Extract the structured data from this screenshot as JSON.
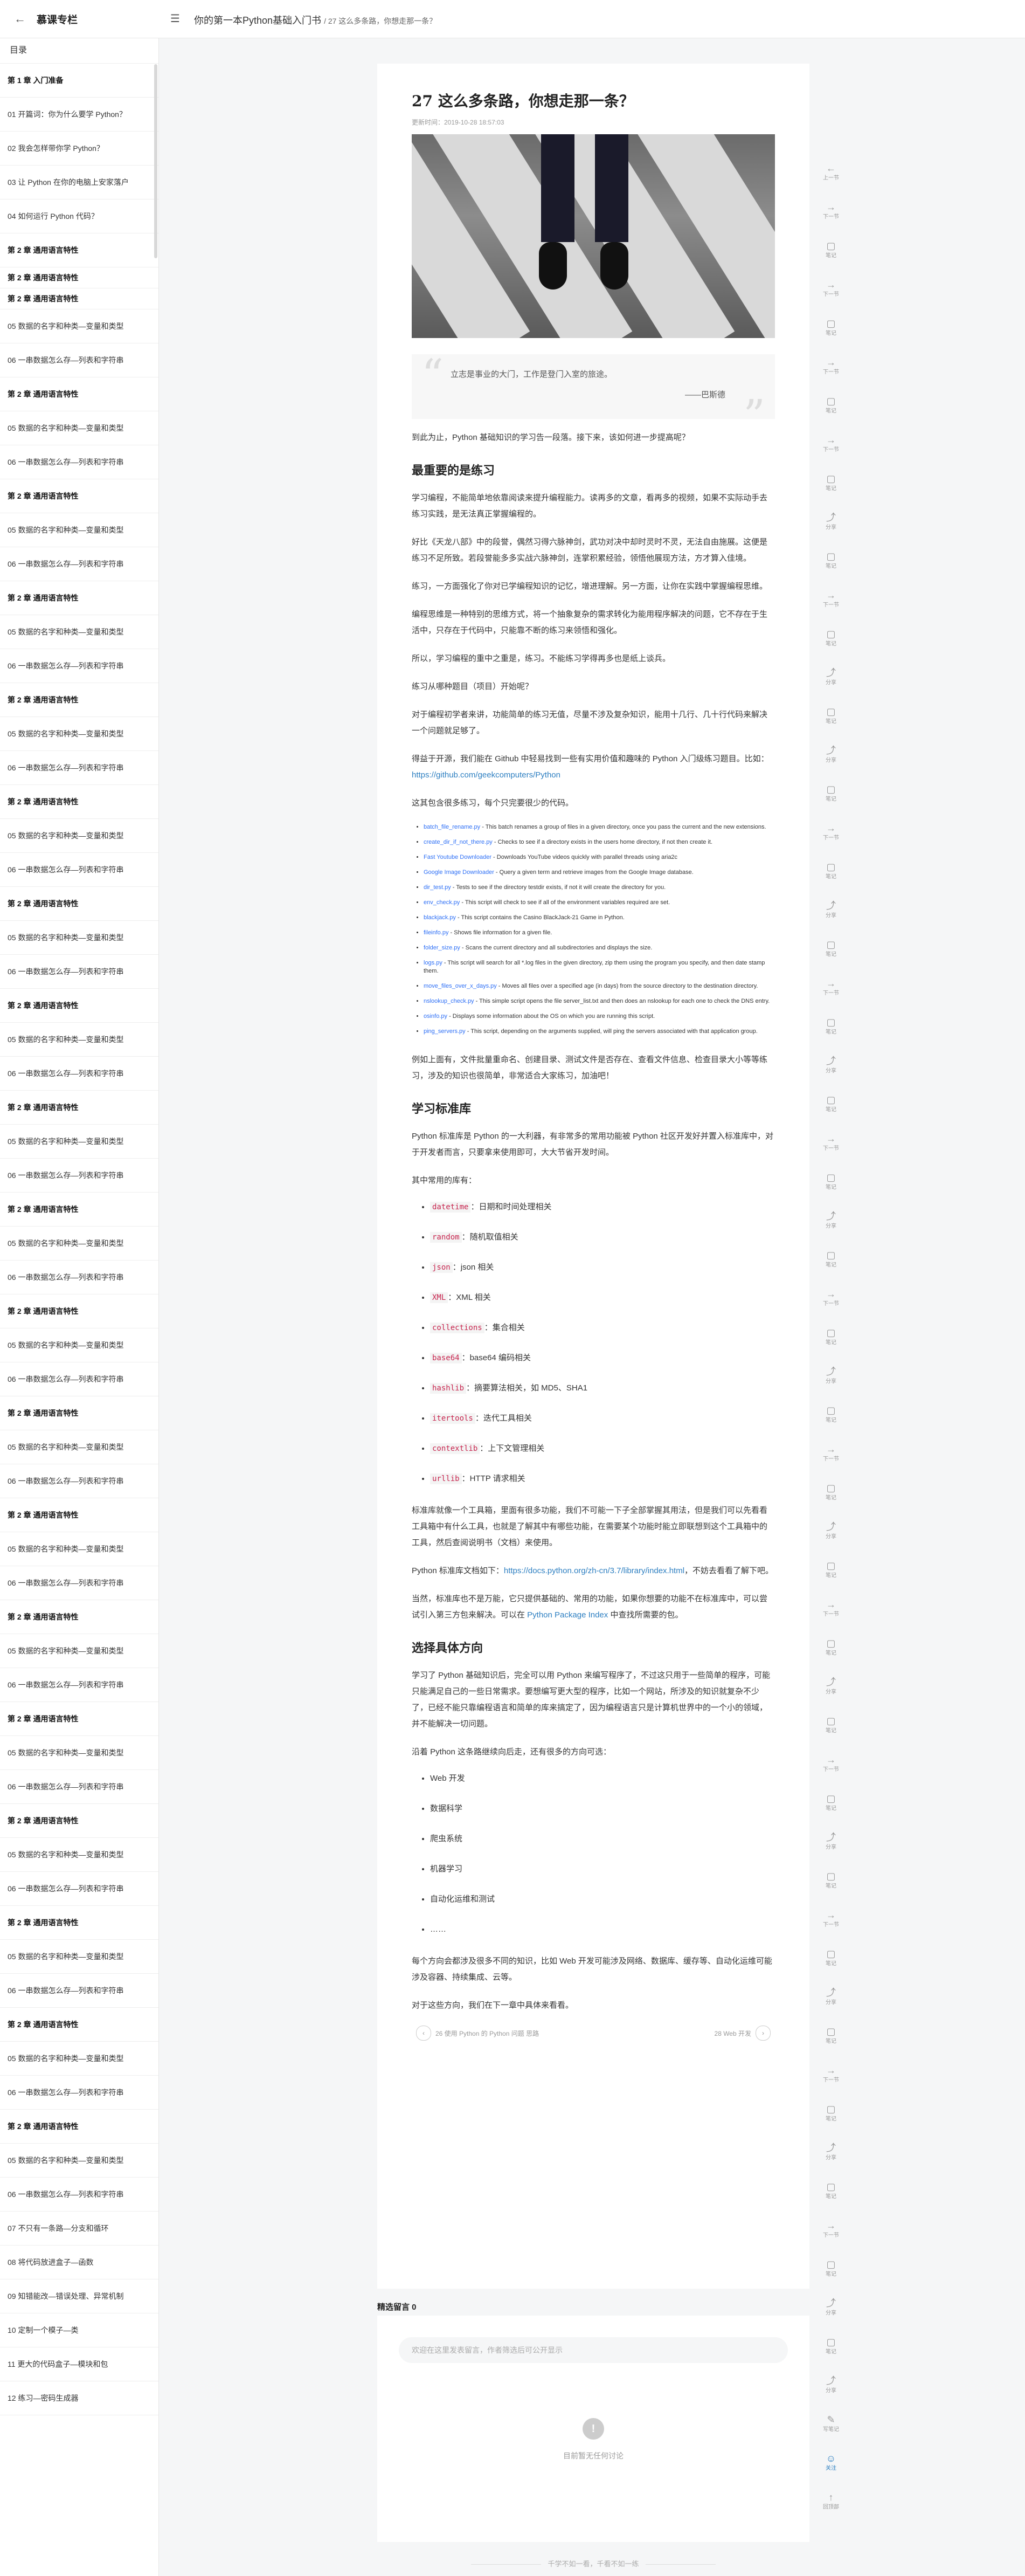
{
  "topbar": {
    "brand": "慕课专栏",
    "book_title": "你的第一本Python基础入门书",
    "article_crumb": "/ 27 这么多条路，你想走那一条？"
  },
  "sidebar": {
    "title": "目录",
    "items": [
      {
        "label": "第 1 章 入门准备",
        "chapter": true
      },
      {
        "label": "01 开篇词：你为什么要学 Python？",
        "chapter": false
      },
      {
        "label": "02 我会怎样带你学 Python？",
        "chapter": false
      },
      {
        "label": "03 让 Python 在你的电脑上安家落户",
        "chapter": false
      },
      {
        "label": "04 如何运行 Python 代码？",
        "chapter": false
      },
      {
        "label": "第 2 章 通用语言特性",
        "chapter": true
      },
      {
        "label": "第 2 章 通用语言特性",
        "chapter": true
      },
      {
        "label": "第 2 章 通用语言特性",
        "chapter": true
      },
      {
        "label": "05 数据的名字和种类—变量和类型",
        "chapter": false
      },
      {
        "label": "06 一串数据怎么存—列表和字符串",
        "chapter": false
      },
      {
        "label": "第 2 章 通用语言特性",
        "chapter": true
      },
      {
        "label": "05 数据的名字和种类—变量和类型",
        "chapter": false
      },
      {
        "label": "06 一串数据怎么存—列表和字符串",
        "chapter": false
      },
      {
        "label": "第 2 章 通用语言特性",
        "chapter": true
      },
      {
        "label": "05 数据的名字和种类—变量和类型",
        "chapter": false
      },
      {
        "label": "06 一串数据怎么存—列表和字符串",
        "chapter": false
      },
      {
        "label": "第 2 章 通用语言特性",
        "chapter": true
      },
      {
        "label": "05 数据的名字和种类—变量和类型",
        "chapter": false
      },
      {
        "label": "06 一串数据怎么存—列表和字符串",
        "chapter": false
      },
      {
        "label": "第 2 章 通用语言特性",
        "chapter": true
      },
      {
        "label": "05 数据的名字和种类—变量和类型",
        "chapter": false
      },
      {
        "label": "06 一串数据怎么存—列表和字符串",
        "chapter": false
      },
      {
        "label": "第 2 章 通用语言特性",
        "chapter": true
      },
      {
        "label": "05 数据的名字和种类—变量和类型",
        "chapter": false
      },
      {
        "label": "06 一串数据怎么存—列表和字符串",
        "chapter": false
      },
      {
        "label": "第 2 章 通用语言特性",
        "chapter": true
      },
      {
        "label": "05 数据的名字和种类—变量和类型",
        "chapter": false
      },
      {
        "label": "06 一串数据怎么存—列表和字符串",
        "chapter": false
      },
      {
        "label": "第 2 章 通用语言特性",
        "chapter": true
      },
      {
        "label": "05 数据的名字和种类—变量和类型",
        "chapter": false
      },
      {
        "label": "06 一串数据怎么存—列表和字符串",
        "chapter": false
      },
      {
        "label": "第 2 章 通用语言特性",
        "chapter": true
      },
      {
        "label": "05 数据的名字和种类—变量和类型",
        "chapter": false
      },
      {
        "label": "06 一串数据怎么存—列表和字符串",
        "chapter": false
      },
      {
        "label": "第 2 章 通用语言特性",
        "chapter": true
      },
      {
        "label": "05 数据的名字和种类—变量和类型",
        "chapter": false
      },
      {
        "label": "06 一串数据怎么存—列表和字符串",
        "chapter": false
      },
      {
        "label": "第 2 章 通用语言特性",
        "chapter": true
      },
      {
        "label": "05 数据的名字和种类—变量和类型",
        "chapter": false
      },
      {
        "label": "06 一串数据怎么存—列表和字符串",
        "chapter": false
      },
      {
        "label": "第 2 章 通用语言特性",
        "chapter": true
      },
      {
        "label": "05 数据的名字和种类—变量和类型",
        "chapter": false
      },
      {
        "label": "06 一串数据怎么存—列表和字符串",
        "chapter": false
      },
      {
        "label": "第 2 章 通用语言特性",
        "chapter": true
      },
      {
        "label": "05 数据的名字和种类—变量和类型",
        "chapter": false
      },
      {
        "label": "06 一串数据怎么存—列表和字符串",
        "chapter": false
      },
      {
        "label": "第 2 章 通用语言特性",
        "chapter": true
      },
      {
        "label": "05 数据的名字和种类—变量和类型",
        "chapter": false
      },
      {
        "label": "06 一串数据怎么存—列表和字符串",
        "chapter": false
      },
      {
        "label": "第 2 章 通用语言特性",
        "chapter": true
      },
      {
        "label": "05 数据的名字和种类—变量和类型",
        "chapter": false
      },
      {
        "label": "06 一串数据怎么存—列表和字符串",
        "chapter": false
      },
      {
        "label": "第 2 章 通用语言特性",
        "chapter": true
      },
      {
        "label": "05 数据的名字和种类—变量和类型",
        "chapter": false
      },
      {
        "label": "06 一串数据怎么存—列表和字符串",
        "chapter": false
      },
      {
        "label": "第 2 章 通用语言特性",
        "chapter": true
      },
      {
        "label": "05 数据的名字和种类—变量和类型",
        "chapter": false
      },
      {
        "label": "06 一串数据怎么存—列表和字符串",
        "chapter": false
      },
      {
        "label": "第 2 章 通用语言特性",
        "chapter": true
      },
      {
        "label": "05 数据的名字和种类—变量和类型",
        "chapter": false
      },
      {
        "label": "06 一串数据怎么存—列表和字符串",
        "chapter": false
      },
      {
        "label": "第 2 章 通用语言特性",
        "chapter": true
      },
      {
        "label": "05 数据的名字和种类—变量和类型",
        "chapter": false
      },
      {
        "label": "06 一串数据怎么存—列表和字符串",
        "chapter": false
      },
      {
        "label": "07 不只有一条路—分支和循环",
        "chapter": false
      },
      {
        "label": "08 将代码放进盒子—函数",
        "chapter": false
      },
      {
        "label": "09 知错能改—错误处理、异常机制",
        "chapter": false
      },
      {
        "label": "10 定制一个模子—类",
        "chapter": false
      },
      {
        "label": "11 更大的代码盒子—模块和包",
        "chapter": false
      },
      {
        "label": "12 练习—密码生成器",
        "chapter": false
      }
    ]
  },
  "article": {
    "title": "27 这么多条路，你想走那一条？",
    "date": "更新时间：2019-10-28 18:57:03",
    "quote_text": "立志是事业的大门，工作是登门入室的旅途。",
    "quote_author": "——巴斯德",
    "intro": "到此为止，Python 基础知识的学习告一段落。接下来，该如何进一步提高呢？",
    "h_practice": "最重要的是练习",
    "p_practice1": "学习编程，不能简单地依靠阅读来提升编程能力。读再多的文章，看再多的视频，如果不实际动手去练习实践，是无法真正掌握编程的。",
    "p_practice2": "好比《天龙八部》中的段誉，偶然习得六脉神剑，武功对决中却时灵时不灵，无法自由施展。这便是练习不足所致。若段誉能多多实战六脉神剑，连掌积累经验，领悟他展现方法，方才算入佳境。",
    "p_practice3": "练习，一方面强化了你对已学编程知识的记忆，增进理解。另一方面，让你在实践中掌握编程思维。",
    "p_practice4": "编程思维是一种特别的思维方式，将一个抽象复杂的需求转化为能用程序解决的问题，它不存在于生活中，只存在于代码中，只能靠不断的练习来领悟和强化。",
    "p_practice5": "所以，学习编程的重中之重是，练习。不能练习学得再多也是纸上谈兵。",
    "p_practice6": "练习从哪种题目（项目）开始呢？",
    "p_practice7": "对于编程初学者来讲，功能简单的练习无值，尽量不涉及复杂知识，能用十几行、几十行代码来解决一个问题就足够了。",
    "p_github_pre": "得益于开源，我们能在 Github 中轻易找到一些有实用价值和趣味的 Python 入门级练习题目。比如：",
    "github_link": "https://github.com/geekcomputers/Python",
    "p_scripts_pre": "这其包含很多练习，每个只完要很少的代码。",
    "scripts": [
      {
        "name": "batch_file_rename.py",
        "desc": " - This batch renames a group of files in a given directory, once you pass the current and the new extensions."
      },
      {
        "name": "create_dir_if_not_there.py",
        "desc": " - Checks to see if a directory exists in the users home directory, if not then create it."
      },
      {
        "name": "Fast Youtube Downloader",
        "desc": " - Downloads YouTube videos quickly with parallel threads using aria2c"
      },
      {
        "name": "Google Image Downloader",
        "desc": " - Query a given term and retrieve images from the Google Image database."
      },
      {
        "name": "dir_test.py",
        "desc": " - Tests to see if the directory testdir exists, if not it will create the directory for you."
      },
      {
        "name": "env_check.py",
        "desc": " - This script will check to see if all of the environment variables required are set."
      },
      {
        "name": "blackjack.py",
        "desc": " - This script contains the Casino BlackJack-21 Game in Python."
      },
      {
        "name": "fileinfo.py",
        "desc": " - Shows file information for a given file."
      },
      {
        "name": "folder_size.py",
        "desc": " - Scans the current directory and all subdirectories and displays the size."
      },
      {
        "name": "logs.py",
        "desc": " - This script will search for all *.log files in the given directory, zip them using the program you specify, and then date stamp them."
      },
      {
        "name": "move_files_over_x_days.py",
        "desc": " - Moves all files over a specified age (in days) from the source directory to the destination directory."
      },
      {
        "name": "nslookup_check.py",
        "desc": " - This simple script opens the file server_list.txt and then does an nslookup for each one to check the DNS entry."
      },
      {
        "name": "osinfo.py",
        "desc": " - Displays some information about the OS on which you are running this script."
      },
      {
        "name": "ping_servers.py",
        "desc": " - This script, depending on the arguments supplied, will ping the servers associated with that application group."
      }
    ],
    "p_scripts_post": "例如上面有，文件批量重命名、创建目录、测试文件是否存在、查看文件信息、检查目录大小等等练习，涉及的知识也很简单，非常适合大家练习，加油吧！",
    "h_stdlib": "学习标准库",
    "p_stdlib1": "Python 标准库是 Python 的一大利器，有非常多的常用功能被 Python 社区开发好并置入标准库中，对于开发者而言，只要拿来使用即可，大大节省开发时间。",
    "p_stdlib2": "其中常用的库有：",
    "libs": [
      {
        "name": "datetime",
        "desc": "：日期和时间处理相关"
      },
      {
        "name": "random",
        "desc": "：随机取值相关"
      },
      {
        "name": "json",
        "desc": "：json 相关"
      },
      {
        "name": "XML",
        "desc": "：XML 相关"
      },
      {
        "name": "collections",
        "desc": "：集合相关"
      },
      {
        "name": "base64",
        "desc": "：base64 编码相关"
      },
      {
        "name": "hashlib",
        "desc": "：摘要算法相关，如 MD5、SHA1"
      },
      {
        "name": "itertools",
        "desc": "：迭代工具相关"
      },
      {
        "name": "contextlib",
        "desc": "：上下文管理相关"
      },
      {
        "name": "urllib",
        "desc": "：HTTP 请求相关"
      }
    ],
    "p_stdlib3": "标准库就像一个工具箱，里面有很多功能，我们不可能一下子全部掌握其用法，但是我们可以先看看工具箱中有什么工具，也就是了解其中有哪些功能，在需要某个功能时能立即联想到这个工具箱中的工具，然后查阅说明书（文档）来使用。",
    "p_stdlib4_pre": "Python 标准库文档如下：",
    "stdlib_doc_link": "https://docs.python.org/zh-cn/3.7/library/index.html",
    "p_stdlib4_post": "，不妨去看看了解下吧。",
    "p_stdlib5_pre": "当然，标准库也不是万能，它只提供基础的、常用的功能，如果你想要的功能不在标准库中，可以尝试引入第三方包来解决。可以在 ",
    "pypi_link": "Python Package Index",
    "p_stdlib5_post": " 中查找所需要的包。",
    "h_direction": "选择具体方向",
    "p_dir1": "学习了 Python 基础知识后，完全可以用 Python 来编写程序了，不过这只用于一些简单的程序，可能只能满足自己的一些日常需求。要想编写更大型的程序，比如一个网站，所涉及的知识就复杂不少了，已经不能只靠编程语言和简单的库来搞定了，因为编程语言只是计算机世界中的一个小的领域，并不能解决一切问题。",
    "p_dir2": "沿着 Python 这条路继续向后走，还有很多的方向可选：",
    "directions": [
      "Web 开发",
      "数据科学",
      "爬虫系统",
      "机器学习",
      "自动化运维和测试",
      "……"
    ],
    "p_dir3": "每个方向会都涉及很多不同的知识，比如 Web 开发可能涉及网络、数据库、缓存等、自动化运维可能涉及容器、持续集成、云等。",
    "p_dir4": "对于这些方向，我们在下一章中具体来看看。",
    "prev_label": "26 使用 Python 的 Python 问题 思路",
    "next_label": "28 Web 开发"
  },
  "comments": {
    "title": "精选留言 0",
    "placeholder": "欢迎在这里发表留言，作者筛选后可公开显示",
    "empty_text": "目前暂无任何讨论"
  },
  "footer": {
    "text": "千学不如一看，千看不如一练"
  },
  "rail": {
    "prev": "上一节",
    "next": "下一节",
    "note": "笔记",
    "share": "分享",
    "bookmark": "书签",
    "qa": "问答",
    "write_note": "写笔记",
    "collect": "收藏",
    "follow": "关注",
    "top": "回顶部"
  },
  "colors": {
    "link": "#2d7fc1",
    "code": "#c7254e",
    "page_bg": "#f5f6f7"
  }
}
